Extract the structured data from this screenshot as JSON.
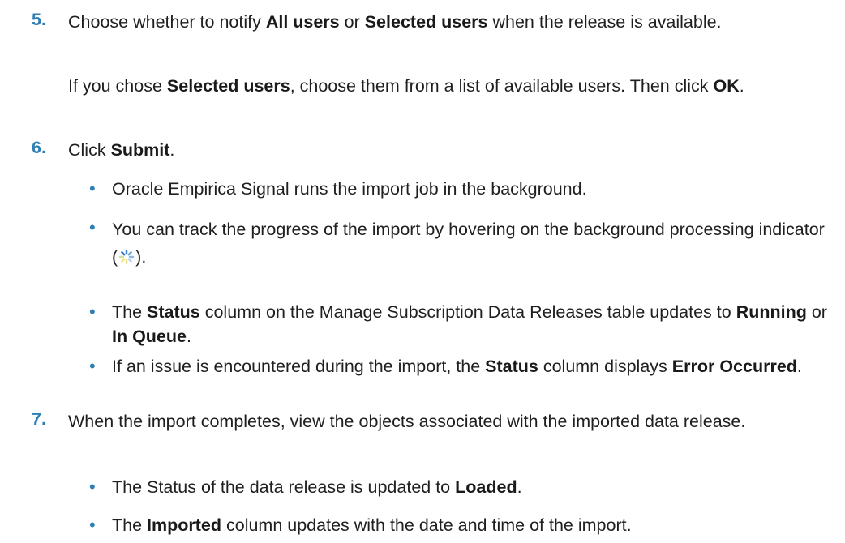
{
  "step5": {
    "number": "5.",
    "t1": "Choose whether to notify ",
    "b1": "All users",
    "t2": " or ",
    "b2": "Selected users",
    "t3": " when the release is available.",
    "sub": {
      "t1": "If you chose ",
      "b1": "Selected users",
      "t2": ", choose them from a list of available users. Then click ",
      "b2": "OK",
      "t3": "."
    }
  },
  "step6": {
    "number": "6.",
    "t1": "Click ",
    "b1": "Submit",
    "t2": ".",
    "bullets": [
      {
        "text": "Oracle Empirica Signal runs the import job in the background."
      },
      {
        "t1": "You can track the progress of the import by hovering on the background processing indicator (",
        "t2": ").",
        "icon": "spinner-icon"
      },
      {
        "t1": "The ",
        "b1": "Status",
        "t2": " column on the Manage Subscription Data Releases table updates to ",
        "b2": "Running",
        "t3": " or ",
        "b3": "In Queue",
        "t4": "."
      },
      {
        "t1": "If an issue is encountered during the import, the ",
        "b1": "Status",
        "t2": " column displays ",
        "b2": "Error Occurred",
        "t3": "."
      }
    ]
  },
  "step7": {
    "number": "7.",
    "text": "When the import completes, view the objects associated with the imported data release.",
    "bullets": [
      {
        "t1": "The Status of the data release is updated to ",
        "b1": "Loaded",
        "t2": "."
      },
      {
        "t1": "The ",
        "b1": "Imported",
        "t2": " column updates with the date and time of the import."
      }
    ]
  },
  "colors": {
    "step_number": "#2f7fb5",
    "bullet": "#2f7fb5",
    "text": "#1f1f1f"
  }
}
